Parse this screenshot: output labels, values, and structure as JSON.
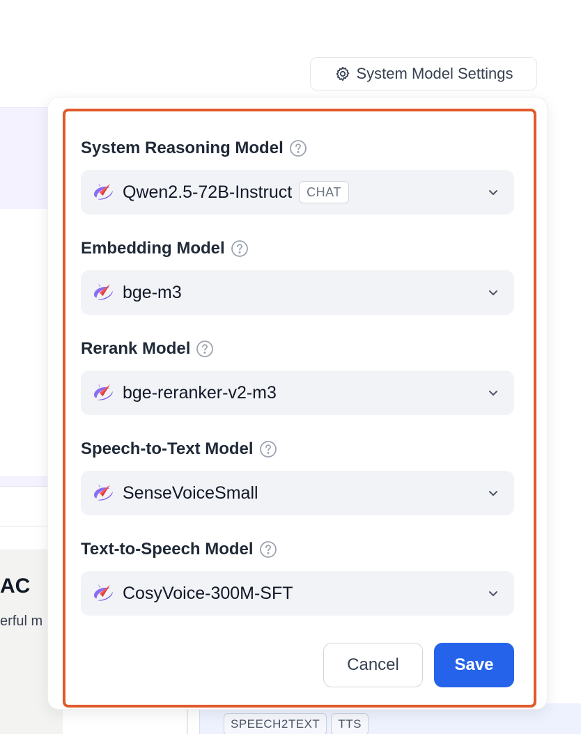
{
  "header": {
    "settings_button_label": "System Model Settings",
    "settings_icon": "gear-icon"
  },
  "background": {
    "card_title_fragment": "AC",
    "card_desc_fragment": "erful m",
    "tags": [
      "SPEECH2TEXT",
      "TTS"
    ]
  },
  "popover": {
    "fields": [
      {
        "label": "System Reasoning Model",
        "value": "Qwen2.5-72B-Instruct",
        "badge": "CHAT"
      },
      {
        "label": "Embedding Model",
        "value": "bge-m3"
      },
      {
        "label": "Rerank Model",
        "value": "bge-reranker-v2-m3"
      },
      {
        "label": "Speech-to-Text Model",
        "value": "SenseVoiceSmall"
      },
      {
        "label": "Text-to-Speech Model",
        "value": "CosyVoice-300M-SFT"
      }
    ],
    "cancel_label": "Cancel",
    "save_label": "Save",
    "highlight_color": "#e05a2a",
    "accent_color": "#2563eb"
  }
}
